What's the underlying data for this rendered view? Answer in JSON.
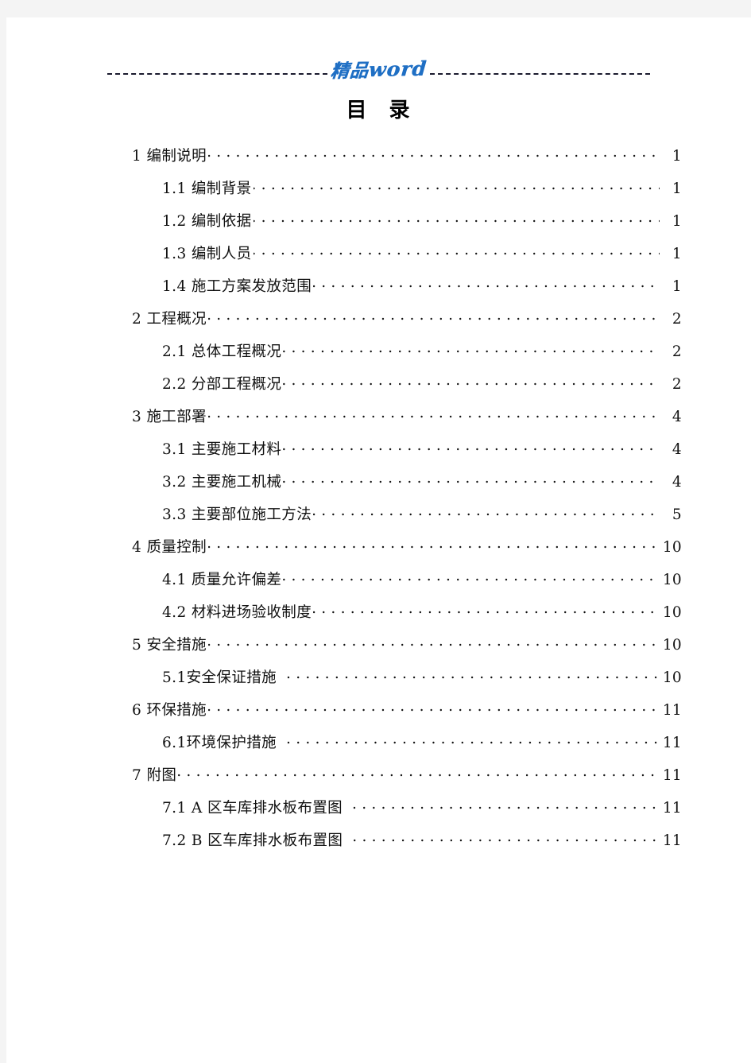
{
  "header": {
    "brand_cn": "精品",
    "brand_en": "word",
    "brand_color": "#1f6fc4",
    "dash_color": "#1a1a2e"
  },
  "document": {
    "title_char_1": "目",
    "title_char_2": "录"
  },
  "toc": {
    "entries": [
      {
        "level": 1,
        "label": "1 编制说明",
        "page": "1",
        "gap_before_dots": false
      },
      {
        "level": 2,
        "label": "1.1 编制背景",
        "page": "1",
        "gap_before_dots": false
      },
      {
        "level": 2,
        "label": "1.2 编制依据",
        "page": "1",
        "gap_before_dots": false
      },
      {
        "level": 2,
        "label": "1.3 编制人员",
        "page": "1",
        "gap_before_dots": false
      },
      {
        "level": 2,
        "label": "1.4 施工方案发放范围",
        "page": "1",
        "gap_before_dots": false
      },
      {
        "level": 1,
        "label": "2 工程概况",
        "page": "2",
        "gap_before_dots": false
      },
      {
        "level": 2,
        "label": "2.1 总体工程概况",
        "page": "2",
        "gap_before_dots": false
      },
      {
        "level": 2,
        "label": "2.2 分部工程概况",
        "page": "2",
        "gap_before_dots": false
      },
      {
        "level": 1,
        "label": "3 施工部署",
        "page": "4",
        "gap_before_dots": false
      },
      {
        "level": 2,
        "label": "3.1 主要施工材料",
        "page": "4",
        "gap_before_dots": false
      },
      {
        "level": 2,
        "label": "3.2 主要施工机械",
        "page": "4",
        "gap_before_dots": false
      },
      {
        "level": 2,
        "label": "3.3 主要部位施工方法",
        "page": "5",
        "gap_before_dots": false
      },
      {
        "level": 1,
        "label": "4 质量控制",
        "page": "10",
        "gap_before_dots": false
      },
      {
        "level": 2,
        "label": "4.1 质量允许偏差",
        "page": "10",
        "gap_before_dots": false
      },
      {
        "level": 2,
        "label": "4.2 材料进场验收制度",
        "page": "10",
        "gap_before_dots": false
      },
      {
        "level": 1,
        "label": "5 安全措施",
        "page": "10",
        "gap_before_dots": false
      },
      {
        "level": 2,
        "label": "5.1安全保证措施",
        "page": "10",
        "gap_before_dots": true
      },
      {
        "level": 1,
        "label": "6 环保措施",
        "page": "11",
        "gap_before_dots": false
      },
      {
        "level": 2,
        "label": "6.1环境保护措施",
        "page": "11",
        "gap_before_dots": true
      },
      {
        "level": 1,
        "label": "7 附图",
        "page": "11",
        "gap_before_dots": false
      },
      {
        "level": 2,
        "label": "7.1 A 区车库排水板布置图",
        "page": "11",
        "gap_before_dots": true
      },
      {
        "level": 2,
        "label": "7.2 B 区车库排水板布置图",
        "page": "11",
        "gap_before_dots": true
      }
    ]
  }
}
